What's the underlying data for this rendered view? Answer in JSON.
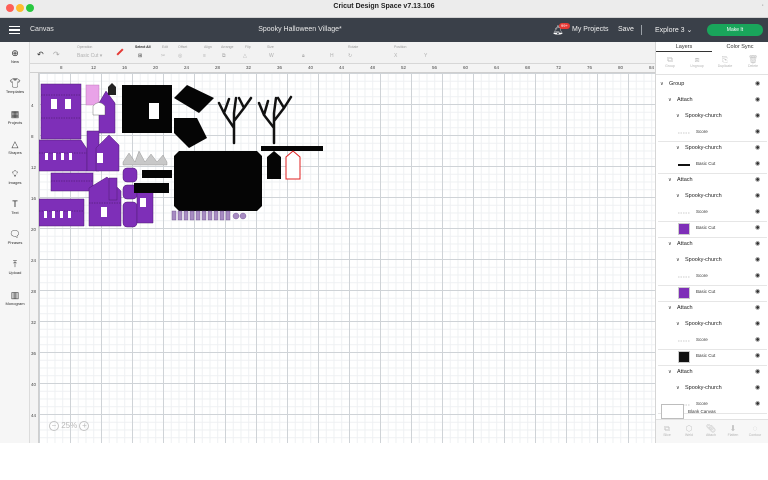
{
  "window": {
    "title": "Cricut Design Space  v7.13.106"
  },
  "header": {
    "canvas_label": "Canvas",
    "project_name": "Spooky Halloween Village*",
    "notification_badge": "99+",
    "my_projects": "My Projects",
    "save": "Save",
    "machine": "Explore 3",
    "make_it": "Make It",
    "accent_color": "#19a55b"
  },
  "toolbar": {
    "operation_label": "Operation",
    "operation_value": "Basic Cut",
    "select_all": "Select All",
    "edit": "Edit",
    "offset": "Offset",
    "align": "Align",
    "arrange": "Arrange",
    "flip": "Flip",
    "size": "Size",
    "rotate": "Rotate",
    "position": "Position"
  },
  "sidebar": {
    "items": [
      {
        "label": "New",
        "icon": "plus-circle-icon"
      },
      {
        "label": "Templates",
        "icon": "shirt-icon"
      },
      {
        "label": "Projects",
        "icon": "grid-icon"
      },
      {
        "label": "Shapes",
        "icon": "shapes-icon"
      },
      {
        "label": "Images",
        "icon": "lightbulb-icon"
      },
      {
        "label": "Text",
        "icon": "text-icon"
      },
      {
        "label": "Phrases",
        "icon": "speech-bubble-icon"
      },
      {
        "label": "Upload",
        "icon": "upload-icon"
      },
      {
        "label": "Monogram",
        "icon": "monogram-icon"
      }
    ]
  },
  "ruler": {
    "top": [
      "8",
      "12",
      "16",
      "20",
      "24",
      "28",
      "32",
      "36",
      "40",
      "44",
      "48",
      "52",
      "56",
      "60",
      "64",
      "68",
      "72",
      "76",
      "80",
      "84"
    ],
    "left": [
      "4",
      "8",
      "12",
      "16",
      "20",
      "24",
      "28",
      "32",
      "36",
      "40",
      "44"
    ]
  },
  "canvas": {
    "zoom": "25%"
  },
  "panel": {
    "tab_layers": "Layers",
    "tab_color_sync": "Color Sync",
    "top_tools": [
      "Group",
      "Ungroup",
      "Duplicate",
      "Delete"
    ],
    "layers": [
      {
        "level": 0,
        "label": "Group",
        "chev": "v"
      },
      {
        "level": 1,
        "label": "Attach",
        "chev": "v"
      },
      {
        "level": 2,
        "label": "Spooky-church",
        "chev": "v"
      },
      {
        "level": 3,
        "label": "Score"
      },
      {
        "level": 2,
        "label": "Spooky-church",
        "chev": "v"
      },
      {
        "level": 3,
        "label": "Basic Cut"
      },
      {
        "level": 1,
        "label": "Attach",
        "chev": "v"
      },
      {
        "level": 2,
        "label": "Spooky-church",
        "chev": "v"
      },
      {
        "level": 3,
        "label": "Score"
      },
      {
        "level": 3,
        "label": "Basic Cut"
      },
      {
        "level": 1,
        "label": "Attach",
        "chev": "v"
      },
      {
        "level": 2,
        "label": "Spooky-church",
        "chev": "v"
      },
      {
        "level": 3,
        "label": "Score"
      },
      {
        "level": 3,
        "label": "Basic Cut"
      },
      {
        "level": 1,
        "label": "Attach",
        "chev": "v"
      },
      {
        "level": 2,
        "label": "Spooky-church",
        "chev": "v"
      },
      {
        "level": 3,
        "label": "Score"
      },
      {
        "level": 3,
        "label": "Basic Cut"
      },
      {
        "level": 1,
        "label": "Attach",
        "chev": "v"
      },
      {
        "level": 2,
        "label": "Spooky-church",
        "chev": "v"
      },
      {
        "level": 3,
        "label": "Score"
      }
    ],
    "blank_canvas": "Blank Canvas",
    "bottom_tools": [
      "Slice",
      "Weld",
      "Attach",
      "Flatten",
      "Contour"
    ]
  }
}
